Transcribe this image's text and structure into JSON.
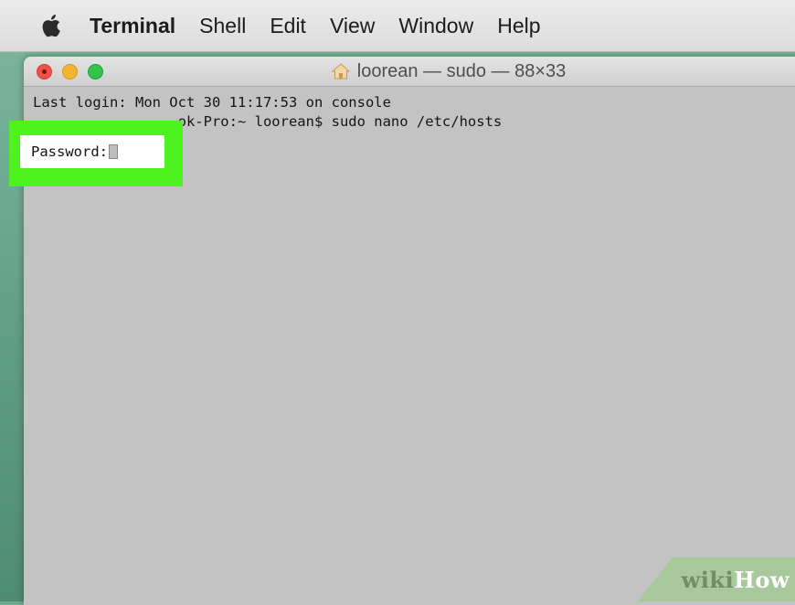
{
  "menubar": {
    "apple_icon": "apple-logo",
    "items": [
      {
        "label": "Terminal",
        "bold": true
      },
      {
        "label": "Shell"
      },
      {
        "label": "Edit"
      },
      {
        "label": "View"
      },
      {
        "label": "Window"
      },
      {
        "label": "Help"
      }
    ]
  },
  "window": {
    "title": "loorean — sudo — 88×33",
    "title_icon": "home-folder-icon",
    "traffic_lights": {
      "close": "#f0504a",
      "minimize": "#f2b431",
      "zoom": "#35c24a"
    }
  },
  "terminal": {
    "lines": [
      "Last login: Mon Oct 30 11:17:53 on console",
      "                 ok-Pro:~ loorean$ sudo nano /etc/hosts"
    ],
    "prompt_label": "Password:"
  },
  "highlight_color": "#4ef21f",
  "watermark": {
    "part1": "wiki",
    "part2": "How"
  }
}
